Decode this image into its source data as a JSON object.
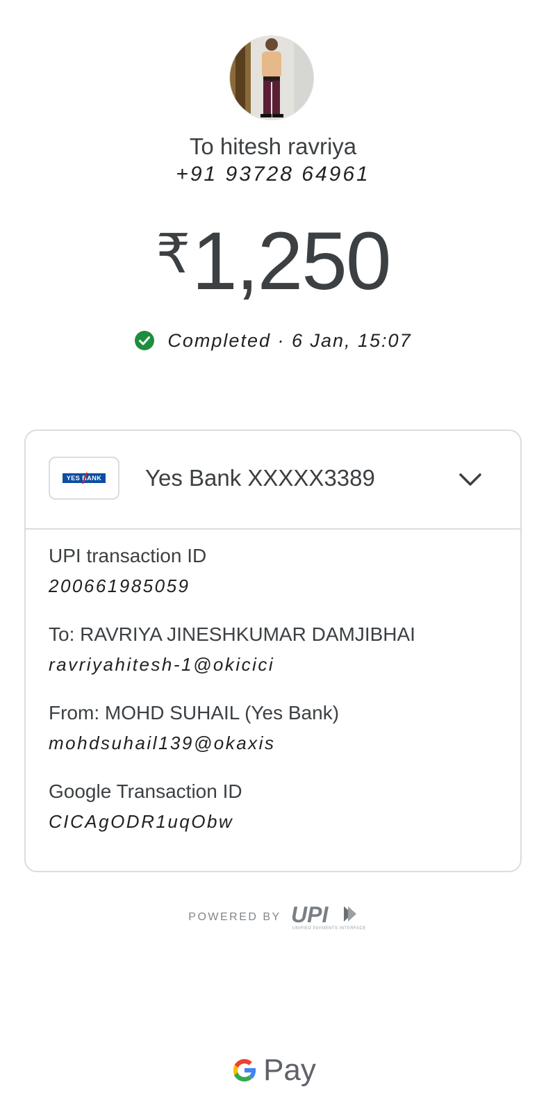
{
  "recipient": {
    "name": "To hitesh ravriya",
    "phone": "+91 93728 64961"
  },
  "payment": {
    "currency_symbol": "₹",
    "amount": "1,250",
    "status": "Completed · 6 Jan, 15:07"
  },
  "account": {
    "bank_logo_text": "YES BANK",
    "label": "Yes Bank XXXXX3389"
  },
  "details": [
    {
      "label": "UPI transaction ID",
      "value": "200661985059"
    },
    {
      "label": "To: RAVRIYA JINESHKUMAR DAMJIBHAI",
      "value": "ravriyahitesh-1@okicici"
    },
    {
      "label": "From: MOHD SUHAIL (Yes Bank)",
      "value": "mohdsuhail139@okaxis"
    },
    {
      "label": "Google Transaction ID",
      "value": "CICAgODR1uqObw"
    }
  ],
  "footer": {
    "powered_by": "POWERED BY",
    "upi_text": "UPI",
    "upi_subtitle": "UNIFIED PAYMENTS INTERFACE",
    "brand_text": "Pay"
  },
  "colors": {
    "success": "#1e8e3e",
    "bank_blue": "#0c4ea2",
    "border": "#dadce0"
  }
}
